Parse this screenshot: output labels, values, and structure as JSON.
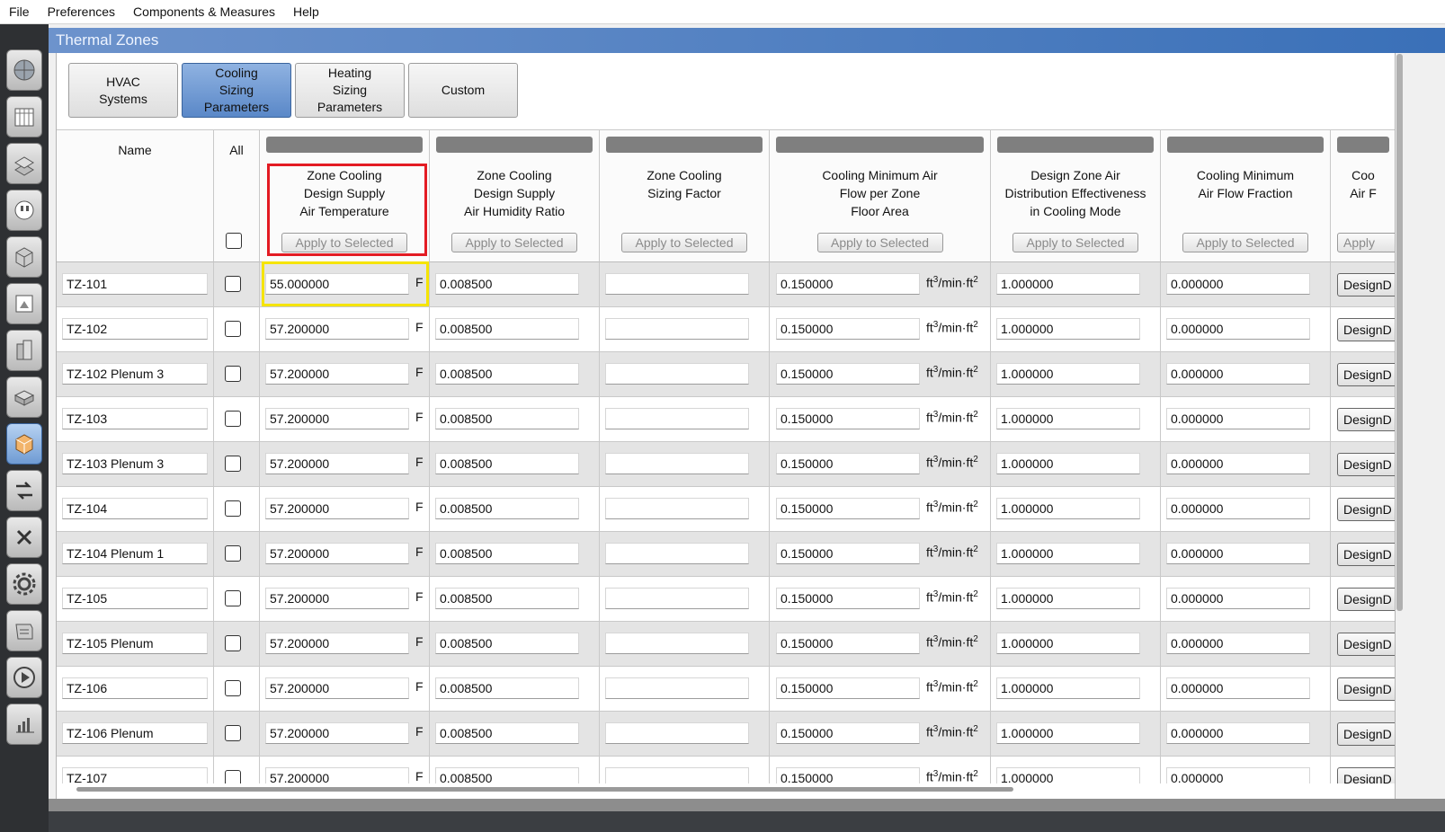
{
  "menu": [
    "File",
    "Preferences",
    "Components & Measures",
    "Help"
  ],
  "sidebar_icons": [
    "site-icon",
    "schedules-icon",
    "constructions-icon",
    "loads-icon",
    "space-types-icon",
    "geometry-icon",
    "facility-icon",
    "spaces-icon",
    "thermal-zones-icon",
    "hvac-systems-icon",
    "variables-icon",
    "simulation-settings-icon",
    "measures-icon",
    "run-simulation-icon",
    "results-summary-icon"
  ],
  "title": "Thermal Zones",
  "tabs": [
    {
      "label": "HVAC\nSystems",
      "active": false
    },
    {
      "label": "Cooling\nSizing\nParameters",
      "active": true
    },
    {
      "label": "Heating\nSizing\nParameters",
      "active": false
    },
    {
      "label": "Custom",
      "active": false
    }
  ],
  "columns": {
    "name": "Name",
    "all": "All",
    "apply_label": "Apply to Selected",
    "fields": [
      "Zone Cooling\nDesign Supply\nAir Temperature",
      "Zone Cooling\nDesign Supply\nAir Humidity Ratio",
      "Zone Cooling\nSizing Factor",
      "Cooling Minimum Air\nFlow per Zone\nFloor Area",
      "Design Zone Air\nDistribution Effectiveness\nin Cooling Mode",
      "Cooling Minimum\nAir Flow Fraction",
      "Coo\nAir F"
    ]
  },
  "units": {
    "temperature": "F",
    "flow_base": "ft",
    "flow_sup1": "3",
    "flow_mid": "/min·ft",
    "flow_sup2": "2"
  },
  "design_button_label": "DesignD",
  "apply_truncated_label": "Apply",
  "rows": [
    {
      "name": "TZ-101",
      "temp": "55.000000",
      "humidity": "0.008500",
      "sizing": "",
      "minflow": "0.150000",
      "effect": "1.000000",
      "fraction": "0.000000"
    },
    {
      "name": "TZ-102",
      "temp": "57.200000",
      "humidity": "0.008500",
      "sizing": "",
      "minflow": "0.150000",
      "effect": "1.000000",
      "fraction": "0.000000"
    },
    {
      "name": "TZ-102 Plenum 3",
      "temp": "57.200000",
      "humidity": "0.008500",
      "sizing": "",
      "minflow": "0.150000",
      "effect": "1.000000",
      "fraction": "0.000000"
    },
    {
      "name": "TZ-103",
      "temp": "57.200000",
      "humidity": "0.008500",
      "sizing": "",
      "minflow": "0.150000",
      "effect": "1.000000",
      "fraction": "0.000000"
    },
    {
      "name": "TZ-103 Plenum 3",
      "temp": "57.200000",
      "humidity": "0.008500",
      "sizing": "",
      "minflow": "0.150000",
      "effect": "1.000000",
      "fraction": "0.000000"
    },
    {
      "name": "TZ-104",
      "temp": "57.200000",
      "humidity": "0.008500",
      "sizing": "",
      "minflow": "0.150000",
      "effect": "1.000000",
      "fraction": "0.000000"
    },
    {
      "name": "TZ-104 Plenum 1",
      "temp": "57.200000",
      "humidity": "0.008500",
      "sizing": "",
      "minflow": "0.150000",
      "effect": "1.000000",
      "fraction": "0.000000"
    },
    {
      "name": "TZ-105",
      "temp": "57.200000",
      "humidity": "0.008500",
      "sizing": "",
      "minflow": "0.150000",
      "effect": "1.000000",
      "fraction": "0.000000"
    },
    {
      "name": "TZ-105 Plenum",
      "temp": "57.200000",
      "humidity": "0.008500",
      "sizing": "",
      "minflow": "0.150000",
      "effect": "1.000000",
      "fraction": "0.000000"
    },
    {
      "name": "TZ-106",
      "temp": "57.200000",
      "humidity": "0.008500",
      "sizing": "",
      "minflow": "0.150000",
      "effect": "1.000000",
      "fraction": "0.000000"
    },
    {
      "name": "TZ-106 Plenum",
      "temp": "57.200000",
      "humidity": "0.008500",
      "sizing": "",
      "minflow": "0.150000",
      "effect": "1.000000",
      "fraction": "0.000000"
    },
    {
      "name": "TZ-107",
      "temp": "57.200000",
      "humidity": "0.008500",
      "sizing": "",
      "minflow": "0.150000",
      "effect": "1.000000",
      "fraction": "0.000000"
    }
  ]
}
